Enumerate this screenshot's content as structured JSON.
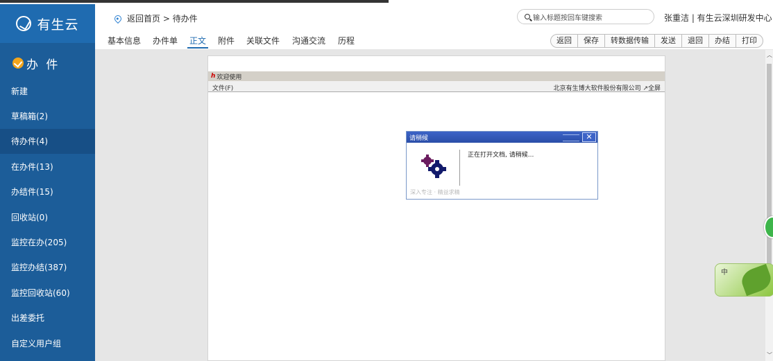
{
  "app": {
    "logo_text": "有生云"
  },
  "sidebar": {
    "section_title": "办 件",
    "items": [
      {
        "label": "新建"
      },
      {
        "label": "草稿箱(2)"
      },
      {
        "label": "待办件(4)"
      },
      {
        "label": "在办件(13)"
      },
      {
        "label": "办结件(15)"
      },
      {
        "label": "回收站(0)"
      },
      {
        "label": "监控在办(205)"
      },
      {
        "label": "监控办结(387)"
      },
      {
        "label": "监控回收站(60)"
      },
      {
        "label": "出差委托"
      },
      {
        "label": "自定义用户组"
      }
    ],
    "active_index": 2
  },
  "header": {
    "breadcrumb": "返回首页 > 待办件",
    "search_placeholder": "输入标题按回车键搜索",
    "user": "张重洁 | 有生云深圳研发中心"
  },
  "tabs": {
    "items": [
      "基本信息",
      "办件单",
      "正文",
      "附件",
      "关联文件",
      "沟通交流",
      "历程"
    ],
    "active": "正文"
  },
  "actions": [
    "返回",
    "保存",
    "转数据传输",
    "发送",
    "退回",
    "办结",
    "打印"
  ],
  "document": {
    "title": "欢迎使用",
    "menu_file": "文件(F)",
    "company": "北京有生博大软件股份有限公司 ↗全屏"
  },
  "dialog": {
    "title": "请稍候",
    "message": "正在打开文档, 请稍候...",
    "footer": "深入专注 · 精益求精",
    "close": "✕"
  },
  "ime": {
    "label": "中"
  },
  "colors": {
    "sidebar": "#1c5d99",
    "accent": "#1f6bb0",
    "dialog_title": "#3c63c7"
  }
}
